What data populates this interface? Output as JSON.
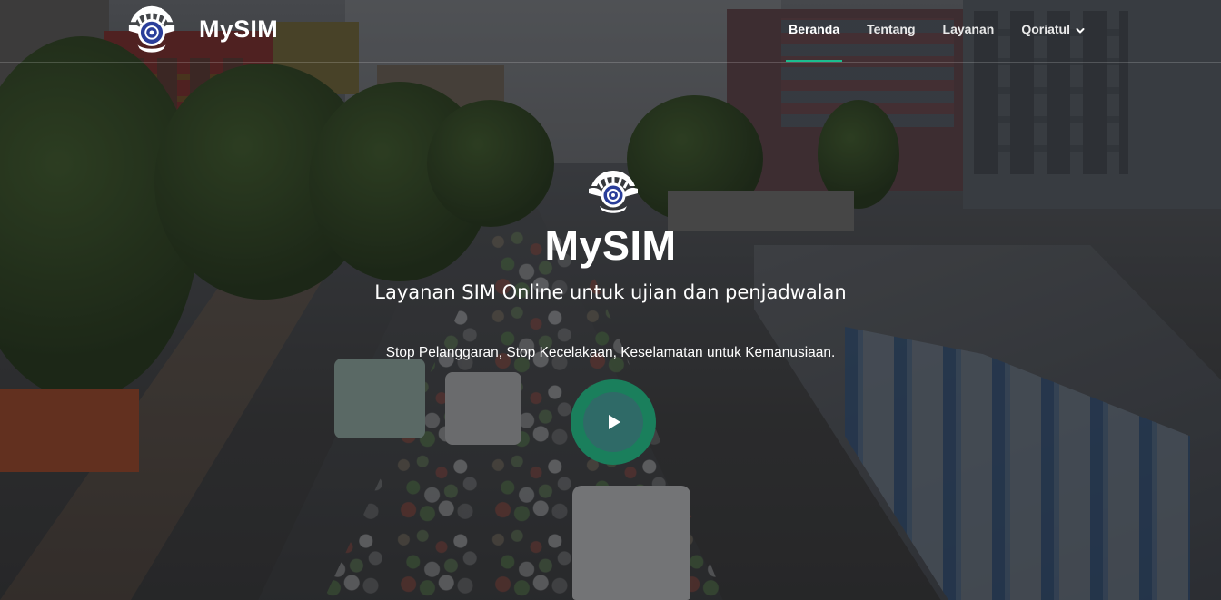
{
  "brand": {
    "name": "MySIM"
  },
  "nav": {
    "items": [
      {
        "label": "Beranda",
        "active": true
      },
      {
        "label": "Tentang",
        "active": false
      },
      {
        "label": "Layanan",
        "active": false
      },
      {
        "label": "Qoriatul",
        "active": false,
        "dropdown": true
      }
    ]
  },
  "hero": {
    "title": "MySIM",
    "subtitle": "Layanan SIM Online untuk ujian dan penjadwalan",
    "tagline": "Stop Pelanggaran, Stop Kecelakaan, Keselamatan untuk Kemanusiaan.",
    "play_icon": "play-icon"
  },
  "colors": {
    "accent": "#1bbd8f",
    "play_ring": "#1a7f5c",
    "play_inner": "#2f6a67",
    "emblem": "#2a3e9a"
  }
}
